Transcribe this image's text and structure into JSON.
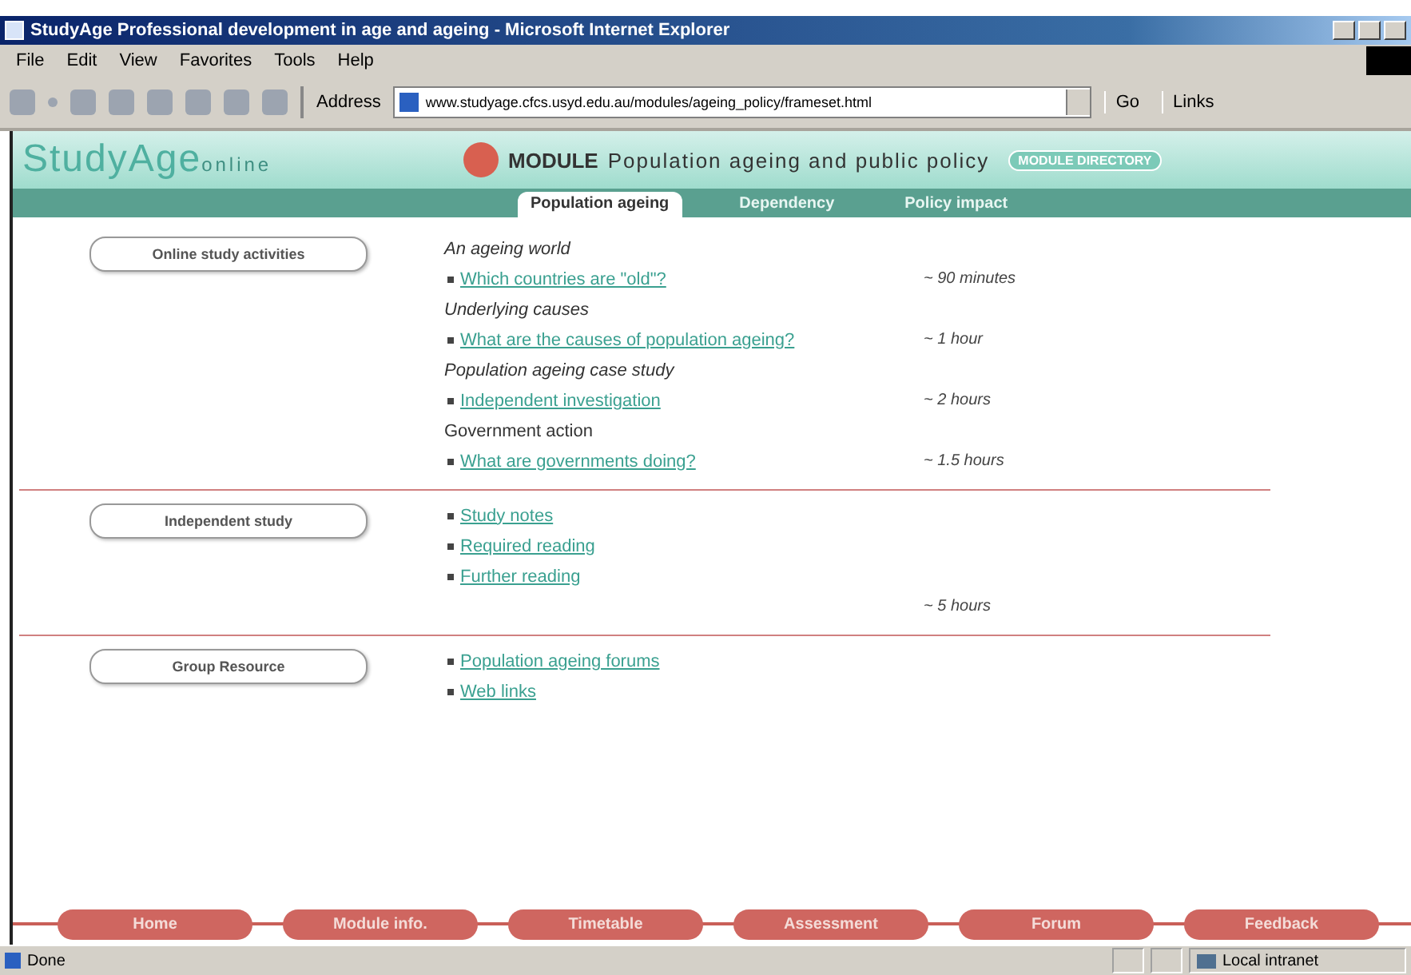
{
  "window": {
    "title": "StudyAge Professional development in age and ageing - Microsoft Internet Explorer"
  },
  "menu_bar": [
    "File",
    "Edit",
    "View",
    "Favorites",
    "Tools",
    "Help"
  ],
  "toolbar": {
    "address_label": "Address",
    "address": "www.studyage.cfcs.usyd.edu.au/modules/ageing_policy/frameset.html",
    "go": "Go",
    "links": "Links"
  },
  "banner": {
    "logo": "StudyAge",
    "logo_suffix": "online",
    "module_label": "MODULE",
    "module_title": "Population ageing and public policy",
    "directory_button": "MODULE DIRECTORY"
  },
  "tabs": [
    {
      "label": "Population ageing",
      "selected": true
    },
    {
      "label": "Dependency",
      "selected": false
    },
    {
      "label": "Policy impact",
      "selected": false
    }
  ],
  "sections": [
    {
      "button": "Online study activities",
      "rows": [
        {
          "kind": "heading",
          "text": "An ageing world",
          "italic": true
        },
        {
          "kind": "link",
          "text": "Which countries are \"old\"?",
          "time": "~ 90 minutes"
        },
        {
          "kind": "heading",
          "text": "Underlying causes",
          "italic": true
        },
        {
          "kind": "link",
          "text": "What are the causes of population ageing?",
          "time": "~ 1 hour"
        },
        {
          "kind": "heading",
          "text": "Population ageing case study",
          "italic": true
        },
        {
          "kind": "link",
          "text": "Independent investigation",
          "time": "~ 2 hours"
        },
        {
          "kind": "heading",
          "text": "Government action",
          "italic": false
        },
        {
          "kind": "link",
          "text": "What are governments doing?",
          "time": "~ 1.5 hours"
        }
      ]
    },
    {
      "button": "Independent study",
      "rows": [
        {
          "kind": "link",
          "text": "Study notes"
        },
        {
          "kind": "link",
          "text": "Required reading"
        },
        {
          "kind": "link",
          "text": "Further reading"
        },
        {
          "kind": "time",
          "time": "~ 5 hours"
        }
      ]
    },
    {
      "button": "Group Resource",
      "rows": [
        {
          "kind": "link",
          "text": "Population ageing forums"
        },
        {
          "kind": "link",
          "text": "Web links"
        }
      ]
    }
  ],
  "bottom_nav": [
    "Home",
    "Module info.",
    "Timetable",
    "Assessment",
    "Forum",
    "Feedback"
  ],
  "status_bar": {
    "text": "Done",
    "zone": "Local intranet"
  }
}
